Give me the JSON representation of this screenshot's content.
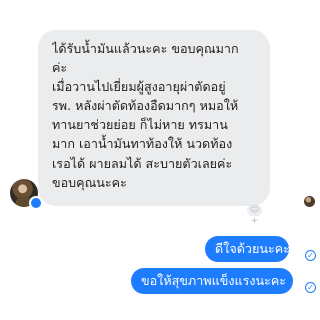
{
  "conversation": {
    "incoming_message": {
      "lines": [
        "ได้รับน้ำมันแล้วนะคะ  ขอบคุณมาก",
        "ค่ะ",
        "เมื่อวานไปเยี่ยมผู้สูงอายุผ่าตัดอยู่",
        "รพ. หลังผ่าตัดท้องอืดมากๆ หมอให้",
        "ทานยาช่วยย่อย ก็ไม่หาย ทรมาน",
        "มาก  เอาน้ำมันทาท้องให้ นวดท้อง",
        "เรอได้ ผายลมได้ สะบายตัวเลยค่ะ",
        "ขอบคุณนะคะ"
      ]
    },
    "outgoing_messages": [
      {
        "text": "ดีใจด้วยนะคะ"
      },
      {
        "text": "ขอให้สุขภาพแข็งแรงนะคะ"
      }
    ],
    "icons": {
      "add_reaction": "add-reaction-icon",
      "sent_check": "check-circle-icon"
    },
    "colors": {
      "incoming_bubble": "#ebeced",
      "outgoing_bubble": "#1e7cff",
      "background": "#ffffff"
    }
  }
}
